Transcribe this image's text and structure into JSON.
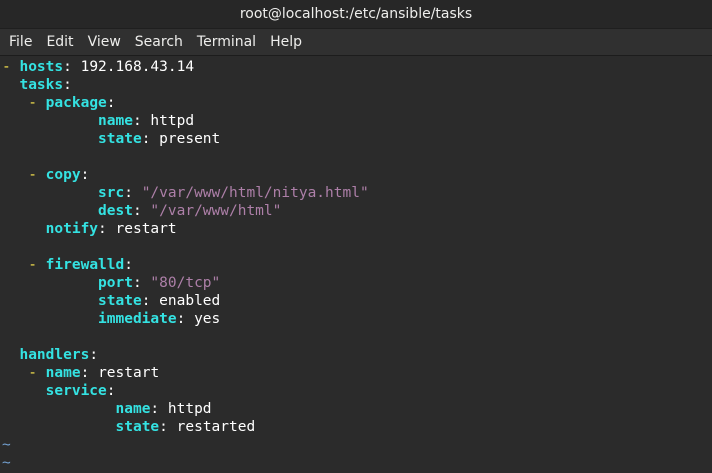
{
  "window": {
    "title": "root@localhost:/etc/ansible/tasks"
  },
  "menu": [
    "File",
    "Edit",
    "View",
    "Search",
    "Terminal",
    "Help"
  ],
  "colors": {
    "key": "#34e2e2",
    "dash": "#fce94f",
    "string": "#ad7fa8",
    "tilde": "#729fcf",
    "background": "#2b2b2b"
  },
  "lines": [
    {
      "indent": "",
      "dash": "- ",
      "key": "hosts",
      "sep": ": ",
      "value": "192.168.43.14",
      "type": "val"
    },
    {
      "indent": "  ",
      "dash": "",
      "key": "tasks",
      "sep": ":",
      "value": "",
      "type": "val"
    },
    {
      "indent": "   ",
      "dash": "- ",
      "key": "package",
      "sep": ":",
      "value": "",
      "type": "val"
    },
    {
      "indent": "           ",
      "dash": "",
      "key": "name",
      "sep": ": ",
      "value": "httpd",
      "type": "val"
    },
    {
      "indent": "           ",
      "dash": "",
      "key": "state",
      "sep": ": ",
      "value": "present",
      "type": "val"
    },
    {
      "indent": "",
      "dash": "",
      "key": "",
      "sep": "",
      "value": "",
      "type": "val"
    },
    {
      "indent": "   ",
      "dash": "- ",
      "key": "copy",
      "sep": ":",
      "value": "",
      "type": "val"
    },
    {
      "indent": "           ",
      "dash": "",
      "key": "src",
      "sep": ": ",
      "value": "\"/var/www/html/nitya.html\"",
      "type": "str"
    },
    {
      "indent": "           ",
      "dash": "",
      "key": "dest",
      "sep": ": ",
      "value": "\"/var/www/html\"",
      "type": "str"
    },
    {
      "indent": "     ",
      "dash": "",
      "key": "notify",
      "sep": ": ",
      "value": "restart",
      "type": "val"
    },
    {
      "indent": "",
      "dash": "",
      "key": "",
      "sep": "",
      "value": "",
      "type": "val"
    },
    {
      "indent": "   ",
      "dash": "- ",
      "key": "firewalld",
      "sep": ":",
      "value": "",
      "type": "val"
    },
    {
      "indent": "           ",
      "dash": "",
      "key": "port",
      "sep": ": ",
      "value": "\"80/tcp\"",
      "type": "str"
    },
    {
      "indent": "           ",
      "dash": "",
      "key": "state",
      "sep": ": ",
      "value": "enabled",
      "type": "val"
    },
    {
      "indent": "           ",
      "dash": "",
      "key": "immediate",
      "sep": ": ",
      "value": "yes",
      "type": "val"
    },
    {
      "indent": "",
      "dash": "",
      "key": "",
      "sep": "",
      "value": "",
      "type": "val"
    },
    {
      "indent": "  ",
      "dash": "",
      "key": "handlers",
      "sep": ":",
      "value": "",
      "type": "val"
    },
    {
      "indent": "   ",
      "dash": "- ",
      "key": "name",
      "sep": ": ",
      "value": "restart",
      "type": "val"
    },
    {
      "indent": "     ",
      "dash": "",
      "key": "service",
      "sep": ":",
      "value": "",
      "type": "val"
    },
    {
      "indent": "             ",
      "dash": "",
      "key": "name",
      "sep": ": ",
      "value": "httpd",
      "type": "val"
    },
    {
      "indent": "             ",
      "dash": "",
      "key": "state",
      "sep": ": ",
      "value": "restarted",
      "type": "val"
    },
    {
      "indent": "",
      "dash": "",
      "key": "",
      "sep": "",
      "value": "",
      "tilde": "~",
      "type": "val"
    },
    {
      "indent": "",
      "dash": "",
      "key": "",
      "sep": "",
      "value": "",
      "tilde": "~",
      "type": "val"
    }
  ]
}
